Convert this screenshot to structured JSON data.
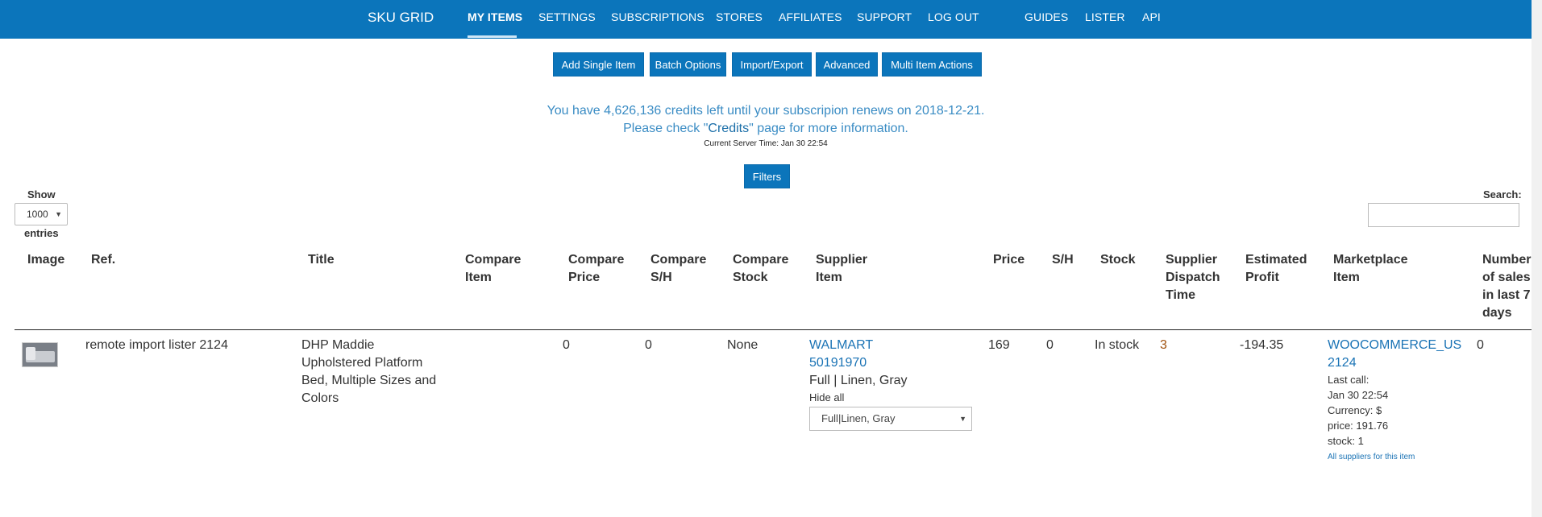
{
  "nav": {
    "brand": "SKU GRID",
    "items": [
      "MY ITEMS",
      "SETTINGS",
      "SUBSCRIPTIONS",
      "STORES",
      "AFFILIATES",
      "SUPPORT",
      "LOG OUT",
      "GUIDES",
      "LISTER",
      "API"
    ],
    "active": "MY ITEMS"
  },
  "actions": [
    "Add Single Item",
    "Batch Options",
    "Import/Export",
    "Advanced",
    "Multi Item Actions"
  ],
  "credits": {
    "line1": "You have 4,626,136 credits left until your subscripion renews on 2018-12-21.",
    "line2_before": "Please check \"",
    "line2_link": "Credits",
    "line2_after": "\" page for more information.",
    "server_time": "Current Server Time: Jan 30 22:54"
  },
  "filters_label": "Filters",
  "table_controls": {
    "show_label": "Show",
    "entries_value": "1000",
    "entries_label": "entries",
    "search_label": "Search:"
  },
  "columns": {
    "image": "Image",
    "ref": "Ref.",
    "title": "Title",
    "compare_item": [
      "Compare",
      "Item"
    ],
    "compare_price": [
      "Compare",
      "Price"
    ],
    "compare_sh": [
      "Compare",
      "S/H"
    ],
    "compare_stock": [
      "Compare",
      "Stock"
    ],
    "supplier_item": [
      "Supplier",
      "Item"
    ],
    "price": "Price",
    "sh": "S/H",
    "stock": "Stock",
    "supplier_dispatch": [
      "Supplier",
      "Dispatch",
      "Time"
    ],
    "estimated_profit": [
      "Estimated",
      "Profit"
    ],
    "marketplace_item": [
      "Marketplace",
      "Item"
    ],
    "sales_last7": [
      "Number",
      "of sales",
      "in last 7",
      "days"
    ]
  },
  "row": {
    "ref": "remote import lister 2124",
    "title_lines": [
      "DHP Maddie",
      "Upholstered Platform",
      "Bed, Multiple Sizes and",
      "Colors"
    ],
    "compare_price": "0",
    "compare_sh": "0",
    "compare_stock": "None",
    "supplier_link_lines": [
      "WALMART",
      "50191970"
    ],
    "supplier_variant": "Full | Linen, Gray",
    "hide_all": "Hide all",
    "variant_select": "Full|Linen, Gray",
    "price": "169",
    "sh": "0",
    "stock": "In stock",
    "dispatch": "3",
    "profit": "-194.35",
    "marketplace_link_lines": [
      "WOOCOMMERCE_US",
      "2124"
    ],
    "last_call_label": "Last call:",
    "last_call_time": "Jan 30 22:54",
    "currency": "Currency: $",
    "mp_price": "price: 191.76",
    "mp_stock": "stock: 1",
    "all_suppliers": "All suppliers for this item",
    "sales": "0"
  }
}
